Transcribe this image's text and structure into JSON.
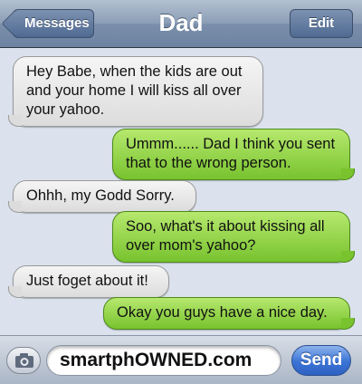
{
  "header": {
    "title": "Dad",
    "back_label": "Messages",
    "edit_label": "Edit"
  },
  "messages": [
    {
      "from": "them",
      "text": "Hey Babe, when the kids are out and your home I will kiss all over your yahoo."
    },
    {
      "from": "me",
      "text": "Ummm...... Dad I think you sent that to the wrong person."
    },
    {
      "from": "them",
      "text": "Ohhh, my Godd Sorry."
    },
    {
      "from": "me",
      "text": "Soo, what's it about kissing all over mom's yahoo?"
    },
    {
      "from": "them",
      "text": "Just foget about it!"
    },
    {
      "from": "me",
      "text": "Okay you guys have a nice day."
    }
  ],
  "composer": {
    "field_text": "smartphOWNED.com",
    "send_label": "Send",
    "camera_icon": "camera-icon"
  },
  "colors": {
    "sent_bubble": "#8fd34a",
    "received_bubble": "#e6e6e6",
    "background": "#dbe2ed",
    "send_button": "#3b73d6"
  }
}
